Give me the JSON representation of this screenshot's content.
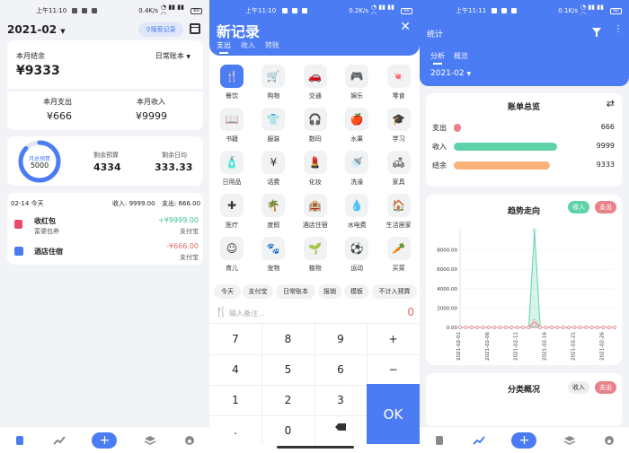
{
  "status_bars": [
    {
      "time": "上午11:10",
      "speed": "0.4K/s",
      "battery": "60"
    },
    {
      "time": "上午11:10",
      "speed": "0.2K/s",
      "battery": "60"
    },
    {
      "time": "上午11:11",
      "speed": "0.1K/s",
      "battery": "60"
    }
  ],
  "overview": {
    "month": "2021-02",
    "search_label": "搜索记录",
    "month_balance_label": "本月结余",
    "book_label": "日常账本",
    "month_balance": "¥9333",
    "expense_label": "本月支出",
    "expense": "¥666",
    "income_label": "本月收入",
    "income": "¥9999",
    "budget_ring_label": "月总预算",
    "budget_ring_value": "5000",
    "budget_ratio": 0.87,
    "remaining_label": "剩余预算",
    "remaining_value": "4334",
    "daily_label": "剩余日均",
    "daily_value": "333.33",
    "day_header": {
      "date": "02-14 今天",
      "income": "收入: 9999.00",
      "expense": "支出: 666.00"
    },
    "records": [
      {
        "name": "收红包",
        "note": "富婆包养",
        "amount": "+¥9999.00",
        "account": "支付宝",
        "color": "#3ec393"
      },
      {
        "name": "酒店住宿",
        "note": "",
        "amount": "-¥666.00",
        "account": "支付宝",
        "color": "#e06a6a"
      }
    ]
  },
  "new_record": {
    "title": "新记录",
    "tabs": [
      "支出",
      "收入",
      "转账"
    ],
    "categories": [
      "餐饮",
      "购物",
      "交通",
      "娱乐",
      "零食",
      "书籍",
      "服装",
      "数码",
      "水果",
      "学习",
      "日用品",
      "话费",
      "化妆",
      "洗澡",
      "家具",
      "医疗",
      "度假",
      "酒店住宿",
      "水电费",
      "生活居家",
      "育儿",
      "宠物",
      "植物",
      "运动",
      "买菜"
    ],
    "category_icons": [
      "fork-knife",
      "cart",
      "car",
      "gamepad",
      "candy",
      "book",
      "tshirt",
      "headphones",
      "apple",
      "cap",
      "bottle",
      "yuan-phone",
      "lipstick",
      "shower",
      "sofa",
      "medkit",
      "palm",
      "hotel",
      "drop",
      "home",
      "baby",
      "paw",
      "sprout",
      "ball",
      "carrot"
    ],
    "chips": [
      "今天",
      "支付宝",
      "日常账本",
      "报销",
      "模板",
      "不计入预算"
    ],
    "note_placeholder": "输入备注...",
    "amount": "0",
    "keys": [
      "7",
      "8",
      "9",
      "+",
      "4",
      "5",
      "6",
      "−",
      "1",
      "2",
      "3",
      "",
      ".",
      "0",
      "",
      ""
    ],
    "ok_label": "OK"
  },
  "stats": {
    "title": "统计",
    "tabs": [
      "分析",
      "概览"
    ],
    "month": "2021-02",
    "summary_title": "账单总览",
    "summary_rows": [
      {
        "label": "支出",
        "value": "666",
        "color": "#e8828a",
        "ratio": 0.067
      },
      {
        "label": "收入",
        "value": "9999",
        "color": "#5fd3a8",
        "ratio": 1.0
      },
      {
        "label": "结余",
        "value": "9333",
        "color": "#f8b27a",
        "ratio": 0.933
      }
    ],
    "trend_title": "趋势走向",
    "income_btn": "收入",
    "expense_btn": "支出",
    "category_title": "分类概况",
    "accent": "#4c7cf3",
    "chart_data": {
      "type": "line",
      "x": [
        "2021-02-01",
        "2021-02-06",
        "2021-02-11",
        "2021-02-16",
        "2021-02-21",
        "2021-02-26"
      ],
      "y_ticks": [
        "0.00",
        "2000.00",
        "4000.00",
        "6000.00",
        "8000.00"
      ],
      "ylim": [
        0,
        10000
      ],
      "days": 28,
      "series": [
        {
          "name": "收入",
          "color": "#5fd3a8",
          "values": [
            0,
            0,
            0,
            0,
            0,
            0,
            0,
            0,
            0,
            0,
            0,
            0,
            0,
            9999,
            0,
            0,
            0,
            0,
            0,
            0,
            0,
            0,
            0,
            0,
            0,
            0,
            0,
            0
          ]
        },
        {
          "name": "支出",
          "color": "#e8828a",
          "values": [
            0,
            0,
            0,
            0,
            0,
            0,
            0,
            0,
            0,
            0,
            0,
            0,
            0,
            666,
            0,
            0,
            0,
            0,
            0,
            0,
            0,
            0,
            0,
            0,
            0,
            0,
            0,
            0
          ]
        }
      ]
    }
  }
}
